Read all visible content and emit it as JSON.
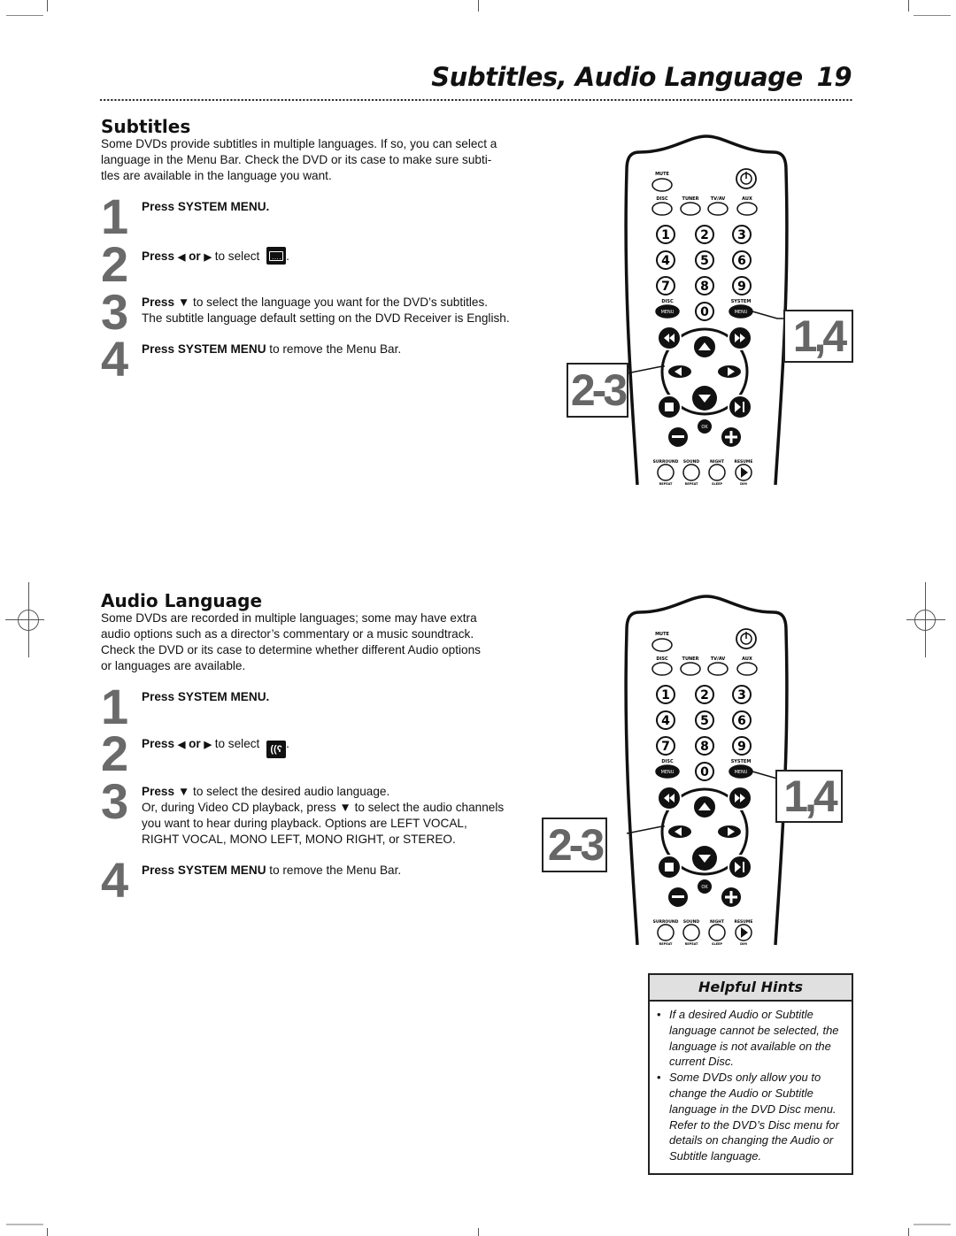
{
  "header": {
    "title": "Subtitles, Audio Language",
    "page_number": "19"
  },
  "subtitles": {
    "heading": "Subtitles",
    "intro": "Some DVDs provide subtitles in multiple languages. If so, you can select a language in the Menu Bar. Check the DVD or its case to make sure subtitles are available in the language you want.",
    "intro_lines": [
      "Some DVDs provide subtitles in multiple languages. If so, you can select a",
      "language in the Menu Bar. Check the DVD or its case to make sure subti-",
      "tles are available in the language you want."
    ],
    "steps": [
      {
        "number": "1",
        "bold": "Press SYSTEM MENU.",
        "rest": ""
      },
      {
        "number": "2",
        "bold_press": "Press",
        "left_arrow": "◀",
        "or": "or",
        "right_arrow": "▶",
        "rest": " to select",
        "icon": "subtitle-icon",
        "end": "."
      },
      {
        "number": "3",
        "bold": "Press ▼",
        "rest": " to select the language you want for the DVD’s subtitles.",
        "line2": "The subtitle language default setting on the DVD Receiver is English."
      },
      {
        "number": "4",
        "bold": "Press SYSTEM MENU",
        "rest": " to remove the Menu Bar."
      }
    ],
    "callouts": {
      "top": "1,4",
      "side": "2-3"
    }
  },
  "audio": {
    "heading": "Audio Language",
    "intro_lines": [
      "Some DVDs are recorded in multiple languages; some may have extra",
      "audio options such as a director’s commentary or a music soundtrack.",
      "Check the DVD or its case to determine whether different Audio options",
      "or languages are available."
    ],
    "steps": [
      {
        "number": "1",
        "bold": "Press SYSTEM MENU.",
        "rest": ""
      },
      {
        "number": "2",
        "bold_press": "Press",
        "left_arrow": "◀",
        "or": "or",
        "right_arrow": "▶",
        "rest": " to select",
        "icon": "audio-icon",
        "end": "."
      },
      {
        "number": "3",
        "bold": "Press ▼",
        "rest": " to select the desired audio language.",
        "lines": [
          "Or, during Video CD playback, press ▼ to select the audio channels",
          "you want to hear during playback. Options are LEFT VOCAL,",
          "RIGHT VOCAL, MONO LEFT, MONO RIGHT, or STEREO."
        ]
      },
      {
        "number": "4",
        "bold": "Press SYSTEM MENU",
        "rest": " to remove the Menu Bar."
      }
    ],
    "callouts": {
      "top": "1,4",
      "side": "2-3"
    }
  },
  "remote": {
    "labels": {
      "mute": "MUTE",
      "disc": "DISC",
      "tuner": "TUNER",
      "tvav": "TV/AV",
      "aux": "AUX",
      "disc_menu_top": "DISC",
      "system_menu_top": "SYSTEM",
      "menu": "MENU",
      "ok": "OK",
      "surround": "SURROUND",
      "sound": "SOUND",
      "night": "NIGHT",
      "resume": "RESUME",
      "repeat": "REPEAT",
      "repeat_ab": "REPEAT",
      "sleep": "SLEEP",
      "dim": "DIM"
    },
    "digits": [
      "1",
      "2",
      "3",
      "4",
      "5",
      "6",
      "7",
      "8",
      "9",
      "0"
    ]
  },
  "hints": {
    "title": "Helpful Hints",
    "items": [
      "If a desired Audio or Subtitle language cannot be selected, the language is not available on the current Disc.",
      "Some DVDs only allow you to change the Audio or Subtitle language in the DVD Disc menu. Refer to the DVD’s Disc menu for details on changing the Audio or Subtitle language."
    ]
  }
}
